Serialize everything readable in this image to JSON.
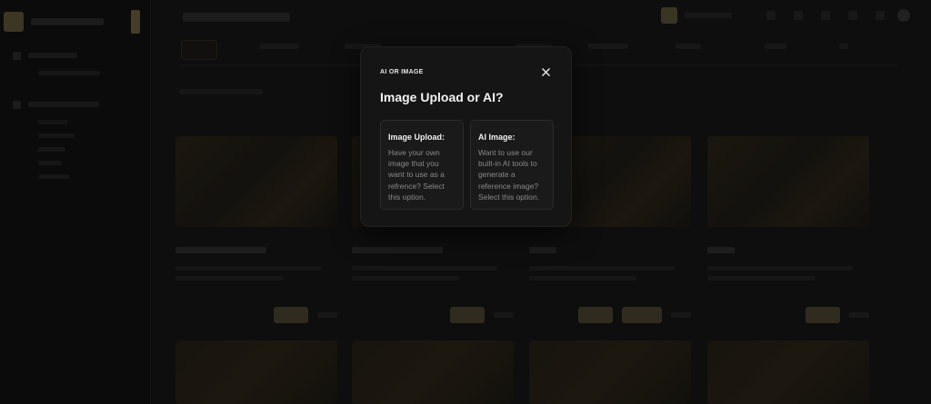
{
  "modal": {
    "eyebrow": "AI OR IMAGE",
    "title": "Image Upload or AI?",
    "close_icon": "close-icon",
    "options": [
      {
        "title": "Image Upload:",
        "description": "Have your own image that you want to use as a refrence? Select this option."
      },
      {
        "title": "AI Image:",
        "description": "Want to use our built-in AI tools to generate a reference image? Select this option."
      }
    ]
  },
  "colors": {
    "modal_bg": "#151515",
    "option_bg": "#1a1a1a",
    "accent_gold": "#6a5f3d",
    "overlay": "rgba(0,0,0,0.35)"
  }
}
